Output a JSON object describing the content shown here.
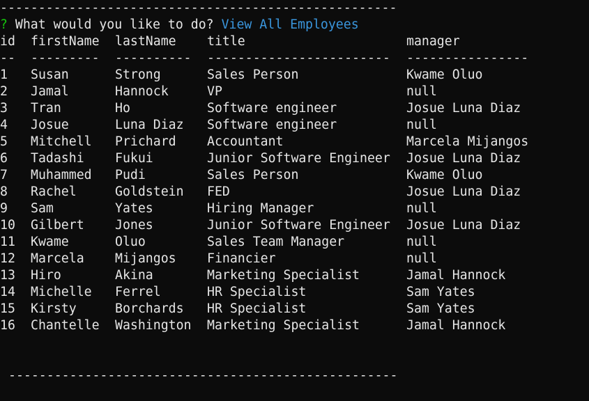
{
  "terminal": {
    "divider_top": "----------------------------------------------------",
    "divider_bottom": "---------------------------------------------------",
    "prompt_symbol": "?",
    "prompt_question": "What would you like to do?",
    "prompt_answer": "View All Employees",
    "colors": {
      "background": "#0c0c0c",
      "text": "#e6e6e6",
      "prompt_symbol": "#16c60c",
      "answer": "#3a96dd"
    }
  },
  "table": {
    "columns": [
      "id",
      "firstName",
      "lastName",
      "title",
      "manager"
    ],
    "underlines": [
      "--",
      "---------",
      "----------",
      "------------------------",
      "----------------"
    ],
    "rows": [
      {
        "id": "1",
        "firstName": "Susan",
        "lastName": "Strong",
        "title": "Sales Person",
        "manager": "Kwame Oluo"
      },
      {
        "id": "2",
        "firstName": "Jamal",
        "lastName": "Hannock",
        "title": "VP",
        "manager": "null"
      },
      {
        "id": "3",
        "firstName": "Tran",
        "lastName": "Ho",
        "title": "Software engineer",
        "manager": "Josue Luna Diaz"
      },
      {
        "id": "4",
        "firstName": "Josue",
        "lastName": "Luna Diaz",
        "title": "Software engineer",
        "manager": "null"
      },
      {
        "id": "5",
        "firstName": "Mitchell",
        "lastName": "Prichard",
        "title": "Accountant",
        "manager": "Marcela Mijangos"
      },
      {
        "id": "6",
        "firstName": "Tadashi",
        "lastName": "Fukui",
        "title": "Junior Software Engineer",
        "manager": "Josue Luna Diaz"
      },
      {
        "id": "7",
        "firstName": "Muhammed",
        "lastName": "Pudi",
        "title": "Sales Person",
        "manager": "Kwame Oluo"
      },
      {
        "id": "8",
        "firstName": "Rachel",
        "lastName": "Goldstein",
        "title": "FED",
        "manager": "Josue Luna Diaz"
      },
      {
        "id": "9",
        "firstName": "Sam",
        "lastName": "Yates",
        "title": "Hiring Manager",
        "manager": "null"
      },
      {
        "id": "10",
        "firstName": "Gilbert",
        "lastName": "Jones",
        "title": "Junior Software Engineer",
        "manager": "Josue Luna Diaz"
      },
      {
        "id": "11",
        "firstName": "Kwame",
        "lastName": "Oluo",
        "title": "Sales Team Manager",
        "manager": "null"
      },
      {
        "id": "12",
        "firstName": "Marcela",
        "lastName": "Mijangos",
        "title": "Financier",
        "manager": "null"
      },
      {
        "id": "13",
        "firstName": "Hiro",
        "lastName": "Akina",
        "title": "Marketing Specialist",
        "manager": "Jamal Hannock"
      },
      {
        "id": "14",
        "firstName": "Michelle",
        "lastName": "Ferrel",
        "title": "HR Specialist",
        "manager": "Sam Yates"
      },
      {
        "id": "15",
        "firstName": "Kirsty",
        "lastName": "Borchards",
        "title": "HR Specialist",
        "manager": "Sam Yates"
      },
      {
        "id": "16",
        "firstName": "Chantelle",
        "lastName": "Washington",
        "title": "Marketing Specialist",
        "manager": "Jamal Hannock"
      }
    ]
  }
}
